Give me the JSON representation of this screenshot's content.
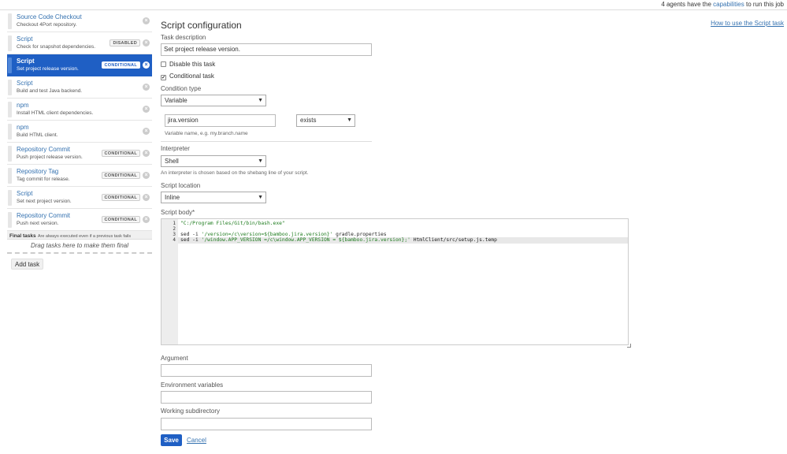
{
  "topbar": {
    "agents_prefix": "4 agents have the",
    "capabilities_link": "capabilities",
    "agents_suffix": "to run this job"
  },
  "sidebar": {
    "tasks": [
      {
        "title": "Source Code Checkout",
        "desc": "Checkout 4Port repository.",
        "badge": ""
      },
      {
        "title": "Script",
        "desc": "Check for snapshot dependencies.",
        "badge": "DISABLED"
      },
      {
        "title": "Script",
        "desc": "Set project release version.",
        "badge": "CONDITIONAL"
      },
      {
        "title": "Script",
        "desc": "Build and test Java backend.",
        "badge": ""
      },
      {
        "title": "npm",
        "desc": "Install HTML client dependencies.",
        "badge": ""
      },
      {
        "title": "npm",
        "desc": "Build HTML client.",
        "badge": ""
      },
      {
        "title": "Repository Commit",
        "desc": "Push project release version.",
        "badge": "CONDITIONAL"
      },
      {
        "title": "Repository Tag",
        "desc": "Tag commit for release.",
        "badge": "CONDITIONAL"
      },
      {
        "title": "Script",
        "desc": "Set next project version.",
        "badge": "CONDITIONAL"
      },
      {
        "title": "Repository Commit",
        "desc": "Push next version.",
        "badge": "CONDITIONAL"
      }
    ],
    "final_label": "Final tasks",
    "final_desc": "Are always executed even if a previous task fails",
    "drop_text": "Drag tasks here to make them final",
    "add_task": "Add task"
  },
  "form": {
    "heading": "Script configuration",
    "howto_link": "How to use the Script task",
    "task_description_label": "Task description",
    "task_description_value": "Set project release version.",
    "disable_label": "Disable this task",
    "disable_checked": false,
    "conditional_label": "Conditional task",
    "conditional_checked": true,
    "condition_type_label": "Condition type",
    "condition_type_value": "Variable",
    "variable_name_value": "jira.version",
    "variable_hint": "Variable name, e.g. my.branch.name",
    "operator_value": "exists",
    "interpreter_label": "Interpreter",
    "interpreter_value": "Shell",
    "interpreter_hint": "An interpreter is chosen based on the shebang line of your script.",
    "script_location_label": "Script location",
    "script_location_value": "Inline",
    "script_body_label": "Script body",
    "script_body_required": "*",
    "code_lines": [
      {
        "num": "1",
        "pre": "",
        "str": "\"C:/Program Files/Git/bin/bash.exe\"",
        "post": ""
      },
      {
        "num": "2",
        "pre": "",
        "str": "",
        "post": ""
      },
      {
        "num": "3",
        "pre": "sed -i ",
        "str": "'/version=/c\\version=${bamboo.jira.version}'",
        "post": " gradle.properties"
      },
      {
        "num": "4",
        "pre": "sed -i ",
        "str": "'/window.APP_VERSION =/c\\window.APP_VERSION = ${bamboo.jira.version};'",
        "post": " HtmlClient/src/setup.js.temp"
      }
    ],
    "argument_label": "Argument",
    "argument_value": "",
    "env_label": "Environment variables",
    "env_value": "",
    "workdir_label": "Working subdirectory",
    "workdir_value": "",
    "save_label": "Save",
    "cancel_label": "Cancel"
  },
  "colors": {
    "accent": "#1f5fc4",
    "link": "#3572b0"
  }
}
